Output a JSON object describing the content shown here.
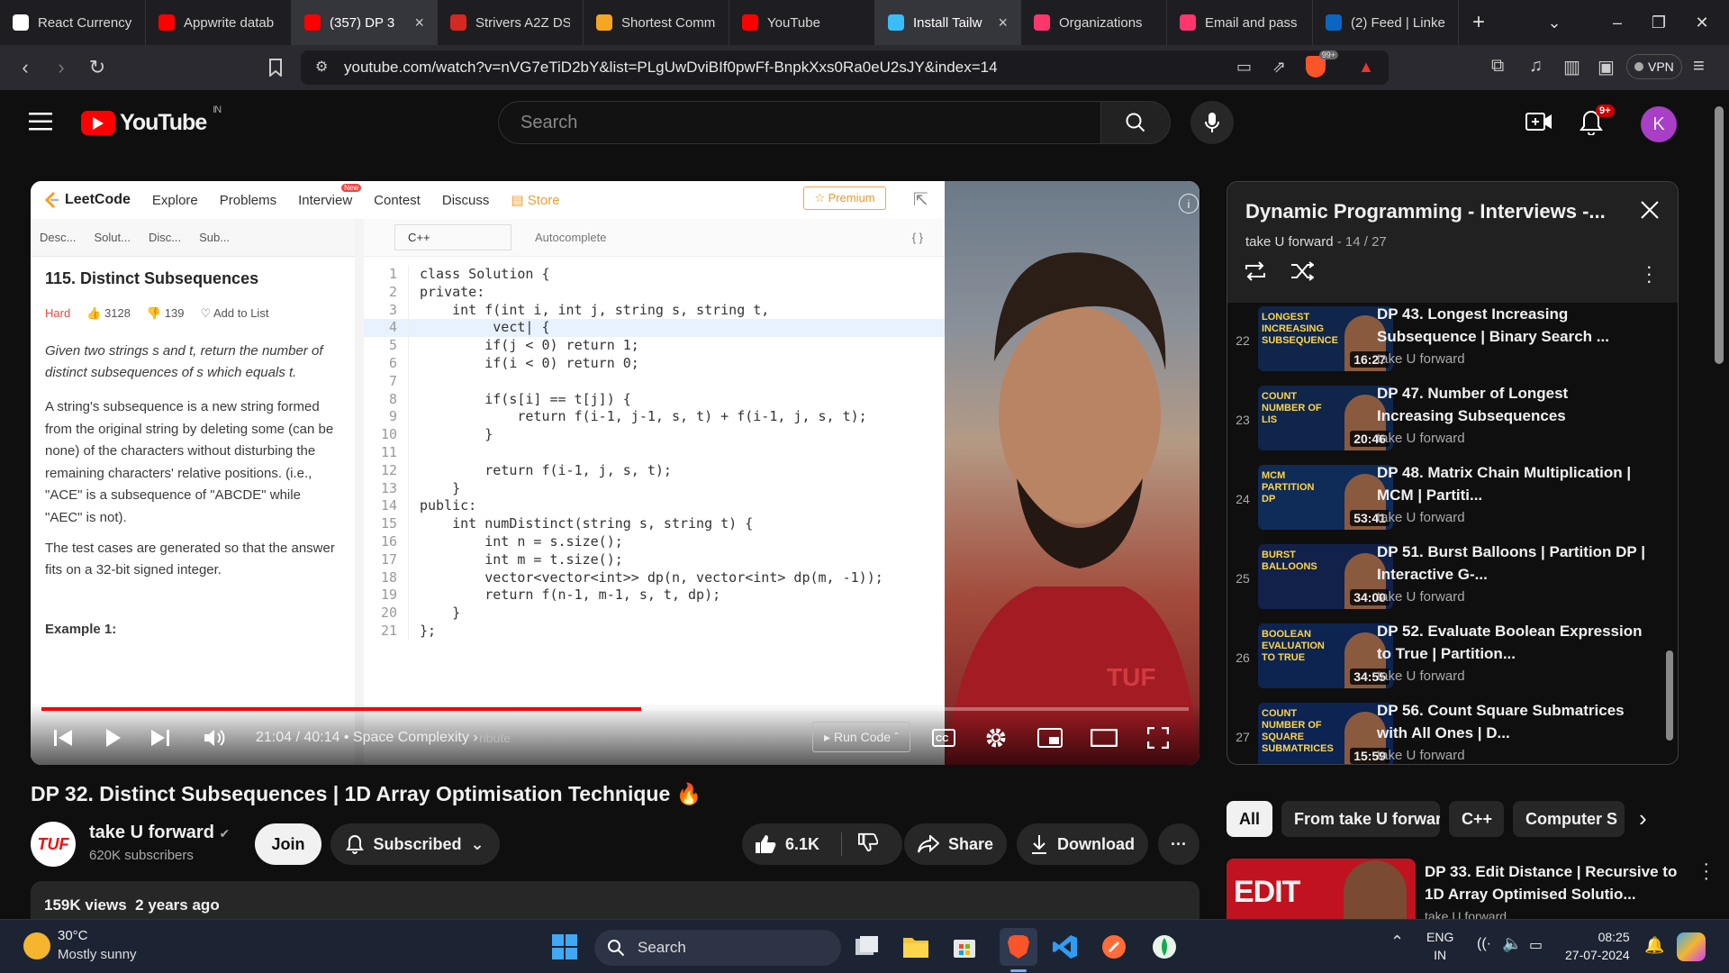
{
  "browser": {
    "tabs": [
      {
        "title": "React Currency",
        "color": "#ffffff",
        "icon": "github-icon"
      },
      {
        "title": "Appwrite datab",
        "color": "#ff0000",
        "icon": "youtube-icon"
      },
      {
        "title": "(357) DP 3",
        "color": "#ff0000",
        "icon": "youtube-icon",
        "active": true
      },
      {
        "title": "Strivers A2Z DS",
        "color": "#d6281e",
        "icon": "tuf-icon"
      },
      {
        "title": "Shortest Comm",
        "color": "#f5a623",
        "icon": "leetcode-icon"
      },
      {
        "title": "YouTube",
        "color": "#ff0000",
        "icon": "youtube-icon"
      },
      {
        "title": "Install Tailw",
        "color": "#38bdf8",
        "icon": "tailwind-icon",
        "active": true
      },
      {
        "title": "Organizations",
        "color": "#fd366e",
        "icon": "appwrite-icon"
      },
      {
        "title": "Email and pass",
        "color": "#fd366e",
        "icon": "appwrite-icon"
      },
      {
        "title": "(2) Feed | Linke",
        "color": "#0a66c2",
        "icon": "linkedin-icon"
      }
    ],
    "url": "youtube.com/watch?v=nVG7eTiD2bY&list=PLgUwDviBIf0pwFf-BnpkXxs0Ra0eU2sJY&index=14",
    "brave_badge": "99+",
    "vpn_label": "VPN"
  },
  "youtube": {
    "logo": "YouTube",
    "region": "IN",
    "search_placeholder": "Search",
    "notif_count": "9+",
    "avatar_letter": "K"
  },
  "leetcode": {
    "logo": "LeetCode",
    "nav": [
      "Explore",
      "Problems",
      "Interview",
      "Contest",
      "Discuss",
      "Store"
    ],
    "new_badge": "New",
    "premium": "☆ Premium",
    "tabs": [
      "Desc...",
      "Solut...",
      "Disc...",
      "Sub..."
    ],
    "language": "C++",
    "autocomplete": "Autocomplete",
    "problem_title": "115. Distinct Subsequences",
    "difficulty": "Hard",
    "likes": "3128",
    "dislikes": "139",
    "add_to_list": "Add to List",
    "para1": "Given two strings s and t, return the number of distinct subsequences of s which equals t.",
    "para2": "A string's subsequence is a new string formed from the original string by deleting some (can be none) of the characters without disturbing the remaining characters' relative positions. (i.e., \"ACE\" is a subsequence of \"ABCDE\" while \"AEC\" is not).",
    "para3": "The test cases are generated so that the answer fits on a 32-bit signed integer.",
    "example": "Example 1:",
    "code": [
      {
        "n": "1",
        "t": "class Solution {"
      },
      {
        "n": "2",
        "t": "private:"
      },
      {
        "n": "3",
        "t": "    int f(int i, int j, string s, string t,"
      },
      {
        "n": "4",
        "t": "         vect| {",
        "hl": true
      },
      {
        "n": "5",
        "t": "        if(j < 0) return 1;"
      },
      {
        "n": "6",
        "t": "        if(i < 0) return 0;"
      },
      {
        "n": "7",
        "t": ""
      },
      {
        "n": "8",
        "t": "        if(s[i] == t[j]) {"
      },
      {
        "n": "9",
        "t": "            return f(i-1, j-1, s, t) + f(i-1, j, s, t);"
      },
      {
        "n": "10",
        "t": "        }"
      },
      {
        "n": "11",
        "t": ""
      },
      {
        "n": "12",
        "t": "        return f(i-1, j, s, t);"
      },
      {
        "n": "13",
        "t": "    }"
      },
      {
        "n": "14",
        "t": "public:"
      },
      {
        "n": "15",
        "t": "    int numDistinct(string s, string t) {"
      },
      {
        "n": "16",
        "t": "        int n = s.size();"
      },
      {
        "n": "17",
        "t": "        int m = t.size();"
      },
      {
        "n": "18",
        "t": "        vector<vector<int>> dp(n, vector<int> dp(m, -1));"
      },
      {
        "n": "19",
        "t": "        return f(n-1, m-1, s, t, dp);"
      },
      {
        "n": "20",
        "t": "    }"
      },
      {
        "n": "21",
        "t": "};"
      }
    ],
    "run_code": "Run Code",
    "contribute": "ribute"
  },
  "player": {
    "time": "21:04 / 40:14",
    "chapter": "Space Complexity",
    "played_fraction": 0.523,
    "loaded_fraction": 0.51,
    "watermark": "TUF"
  },
  "playlist": {
    "title": "Dynamic Programming - Interviews -...",
    "channel": "take U forward",
    "position": "14 / 27",
    "items": [
      {
        "idx": "22",
        "title": "DP 43. Longest Increasing Subsequence | Binary Search ...",
        "channel": "take U forward",
        "duration": "16:27",
        "thumb_label": "Longest Increasing Subsequence"
      },
      {
        "idx": "23",
        "title": "DP 47. Number of Longest Increasing Subsequences",
        "channel": "take U forward",
        "duration": "20:46",
        "thumb_label": "Count Number of LIS"
      },
      {
        "idx": "24",
        "title": "DP 48. Matrix Chain Multiplication | MCM | Partiti...",
        "channel": "take U forward",
        "duration": "53:41",
        "thumb_label": "MCM Partition DP"
      },
      {
        "idx": "25",
        "title": "DP 51. Burst Balloons | Partition DP | Interactive G-...",
        "channel": "take U forward",
        "duration": "34:00",
        "thumb_label": "Burst Balloons"
      },
      {
        "idx": "26",
        "title": "DP 52. Evaluate Boolean Expression to True | Partition...",
        "channel": "take U forward",
        "duration": "34:55",
        "thumb_label": "Boolean Evaluation to True"
      },
      {
        "idx": "27",
        "title": "DP 56. Count Square Submatrices with All Ones | D...",
        "channel": "take U forward",
        "duration": "15:59",
        "thumb_label": "Count Number of Square Submatrices"
      }
    ]
  },
  "video": {
    "title": "DP 32. Distinct Subsequences | 1D Array Optimisation Technique 🔥",
    "channel": "take U forward",
    "subscribers": "620K subscribers",
    "join": "Join",
    "subscribed": "Subscribed",
    "likes": "6.1K",
    "share": "Share",
    "download": "Download",
    "views": "159K views",
    "age": "2 years ago"
  },
  "chips": [
    "All",
    "From take U forward",
    "C++",
    "Computer S"
  ],
  "recommendation": {
    "title": "DP 33. Edit Distance | Recursive to 1D Array Optimised Solutio...",
    "channel": "take U forward",
    "thumb_label": "EDIT"
  },
  "taskbar": {
    "weather_temp": "30°C",
    "weather_desc": "Mostly sunny",
    "search": "Search",
    "lang": "ENG",
    "region": "IN",
    "time": "08:25",
    "date": "27-07-2024"
  }
}
